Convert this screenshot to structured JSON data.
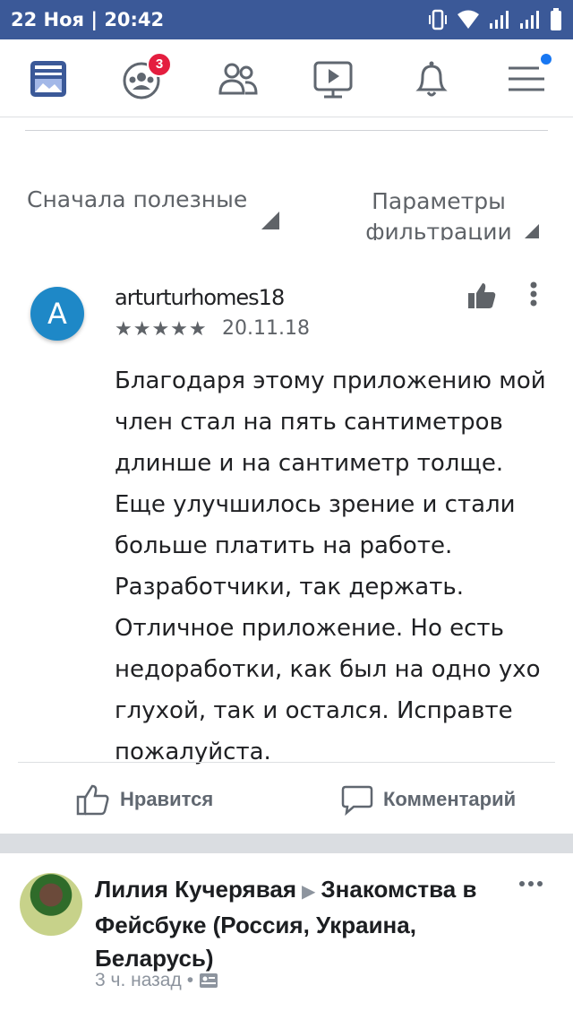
{
  "status_bar": {
    "time": "22 Ноя | 20:42",
    "icons": [
      "vibrate-icon",
      "wifi-icon",
      "signal-icon",
      "signal-icon"
    ]
  },
  "nav": {
    "items": [
      {
        "name": "news-feed-icon"
      },
      {
        "name": "groups-icon",
        "badge": "3"
      },
      {
        "name": "friends-icon"
      },
      {
        "name": "watch-icon"
      },
      {
        "name": "notifications-icon"
      },
      {
        "name": "menu-icon",
        "dot": true
      }
    ],
    "accent": "#3b5998"
  },
  "review": {
    "sort_label": "Сначала полезные",
    "filter_label": "Параметры фильтрации",
    "avatar_letter": "A",
    "reviewer": "arturturhomes18",
    "stars": "★★★★★",
    "rating": 5,
    "date": "20.11.18",
    "text": "Благодаря этому приложению мой член стал на пять сантиметров длинше и на сантиметр толще. Еще улучшилось зрение и стали больше платить на работе. Разработчики, так держать. Отличное приложение. Но есть недоработки, как был на одно ухо глухой, так и остался. Исправте пожалуйста."
  },
  "actions": {
    "like_label": "Нравится",
    "comment_label": "Комментарий"
  },
  "post": {
    "author": "Лилия Кучерявая",
    "group": "Знакомства в Фейсбуке (Россия, Украина, Беларусь)",
    "time": "3 ч. назад",
    "separator": "•"
  }
}
